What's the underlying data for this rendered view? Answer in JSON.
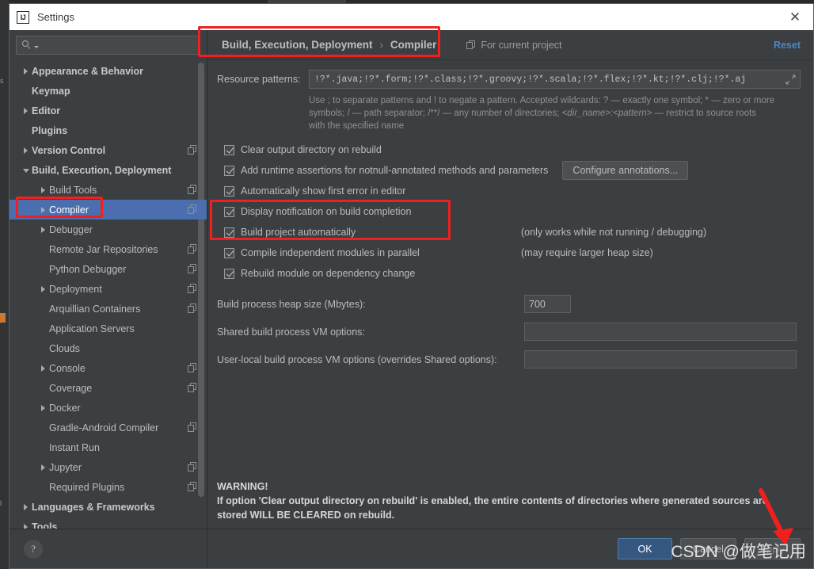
{
  "window": {
    "title": "Settings",
    "logo_text": "IJ",
    "close_label": "✕"
  },
  "search": {
    "value": "",
    "placeholder": ""
  },
  "sidebar": {
    "items": [
      {
        "label": "Appearance & Behavior",
        "indent": 0,
        "arrow": "right",
        "bold": true,
        "copy": false,
        "selected": false
      },
      {
        "label": "Keymap",
        "indent": 0,
        "arrow": "none",
        "bold": true,
        "copy": false,
        "selected": false
      },
      {
        "label": "Editor",
        "indent": 0,
        "arrow": "right",
        "bold": true,
        "copy": false,
        "selected": false
      },
      {
        "label": "Plugins",
        "indent": 0,
        "arrow": "none",
        "bold": true,
        "copy": false,
        "selected": false
      },
      {
        "label": "Version Control",
        "indent": 0,
        "arrow": "right",
        "bold": true,
        "copy": true,
        "selected": false
      },
      {
        "label": "Build, Execution, Deployment",
        "indent": 0,
        "arrow": "down",
        "bold": true,
        "copy": false,
        "selected": false
      },
      {
        "label": "Build Tools",
        "indent": 1,
        "arrow": "right",
        "bold": false,
        "copy": true,
        "selected": false
      },
      {
        "label": "Compiler",
        "indent": 1,
        "arrow": "right",
        "bold": false,
        "copy": true,
        "selected": true
      },
      {
        "label": "Debugger",
        "indent": 1,
        "arrow": "right",
        "bold": false,
        "copy": false,
        "selected": false
      },
      {
        "label": "Remote Jar Repositories",
        "indent": 1,
        "arrow": "none",
        "bold": false,
        "copy": true,
        "selected": false
      },
      {
        "label": "Python Debugger",
        "indent": 1,
        "arrow": "none",
        "bold": false,
        "copy": true,
        "selected": false
      },
      {
        "label": "Deployment",
        "indent": 1,
        "arrow": "right",
        "bold": false,
        "copy": true,
        "selected": false
      },
      {
        "label": "Arquillian Containers",
        "indent": 1,
        "arrow": "none",
        "bold": false,
        "copy": true,
        "selected": false
      },
      {
        "label": "Application Servers",
        "indent": 1,
        "arrow": "none",
        "bold": false,
        "copy": false,
        "selected": false
      },
      {
        "label": "Clouds",
        "indent": 1,
        "arrow": "none",
        "bold": false,
        "copy": false,
        "selected": false
      },
      {
        "label": "Console",
        "indent": 1,
        "arrow": "right",
        "bold": false,
        "copy": true,
        "selected": false
      },
      {
        "label": "Coverage",
        "indent": 1,
        "arrow": "none",
        "bold": false,
        "copy": true,
        "selected": false
      },
      {
        "label": "Docker",
        "indent": 1,
        "arrow": "right",
        "bold": false,
        "copy": false,
        "selected": false
      },
      {
        "label": "Gradle-Android Compiler",
        "indent": 1,
        "arrow": "none",
        "bold": false,
        "copy": true,
        "selected": false
      },
      {
        "label": "Instant Run",
        "indent": 1,
        "arrow": "none",
        "bold": false,
        "copy": false,
        "selected": false
      },
      {
        "label": "Jupyter",
        "indent": 1,
        "arrow": "right",
        "bold": false,
        "copy": true,
        "selected": false
      },
      {
        "label": "Required Plugins",
        "indent": 1,
        "arrow": "none",
        "bold": false,
        "copy": true,
        "selected": false
      },
      {
        "label": "Languages & Frameworks",
        "indent": 0,
        "arrow": "right",
        "bold": true,
        "copy": false,
        "selected": false
      },
      {
        "label": "Tools",
        "indent": 0,
        "arrow": "right",
        "bold": true,
        "copy": false,
        "selected": false
      }
    ],
    "help_glyph": "?"
  },
  "header": {
    "breadcrumb_parent": "Build, Execution, Deployment",
    "breadcrumb_sep": "›",
    "breadcrumb_current": "Compiler",
    "for_current_project": "For current project",
    "reset_label": "Reset"
  },
  "compiler": {
    "resource_patterns_label": "Resource patterns:",
    "resource_patterns_value": "!?*.java;!?*.form;!?*.class;!?*.groovy;!?*.scala;!?*.flex;!?*.kt;!?*.clj;!?*.aj",
    "hint_line1": "Use ; to separate patterns and ! to negate a pattern. Accepted wildcards: ? — exactly one symbol; * — zero or more",
    "hint_line2a": "symbols; / — path separator; /**/ — any number of directories;  ",
    "hint_line2b": "<dir_name>:<pattern>",
    "hint_line2c": " — restrict to source roots",
    "hint_line3": "with the specified name",
    "checkboxes": [
      {
        "label": "Clear output directory on rebuild",
        "checked": true,
        "note": ""
      },
      {
        "label": "Add runtime assertions for notnull-annotated methods and parameters",
        "checked": true,
        "note": ""
      },
      {
        "label": "Automatically show first error in editor",
        "checked": true,
        "note": ""
      },
      {
        "label": "Display notification on build completion",
        "checked": true,
        "note": ""
      },
      {
        "label": "Build project automatically",
        "checked": true,
        "note": "(only works while not running / debugging)"
      },
      {
        "label": "Compile independent modules in parallel",
        "checked": true,
        "note": "(may require larger heap size)"
      },
      {
        "label": "Rebuild module on dependency change",
        "checked": true,
        "note": ""
      }
    ],
    "configure_annotations_label": "Configure annotations...",
    "heap_label": "Build process heap size (Mbytes):",
    "heap_value": "700",
    "shared_vm_label": "Shared build process VM options:",
    "shared_vm_value": "",
    "user_local_vm_label": "User-local build process VM options (overrides Shared options):",
    "user_local_vm_value": "",
    "warning_title": "WARNING!",
    "warning_line1": "If option 'Clear output directory on rebuild' is enabled, the entire contents of directories where generated sources are",
    "warning_line2": "stored WILL BE CLEARED on rebuild."
  },
  "footer": {
    "ok_label": "OK",
    "cancel_label": "Cancel",
    "apply_label": "Apply"
  },
  "watermark": "CSDN @做笔记用",
  "colors": {
    "accent_blue": "#4b6eaf",
    "link_blue": "#4a86c8",
    "primary_button": "#365880",
    "annotation_red": "#f21f1f",
    "window_bg": "#3c3f41",
    "titlebar_bg": "#ffffff"
  }
}
